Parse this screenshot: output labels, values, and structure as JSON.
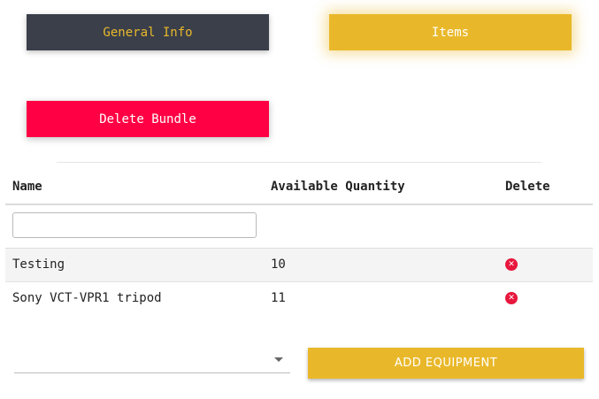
{
  "tabs": {
    "general_info": "General Info",
    "items": "Items"
  },
  "actions": {
    "delete_bundle": "Delete Bundle",
    "add_equipment": "ADD EQUIPMENT"
  },
  "table": {
    "headers": {
      "name": "Name",
      "available_quantity": "Available Quantity",
      "delete": "Delete"
    },
    "filter": {
      "value": "",
      "placeholder": ""
    },
    "rows": [
      {
        "name": "Testing",
        "quantity": "10",
        "delete_icon": "remove-circle-icon"
      },
      {
        "name": "Sony VCT-VPR1 tripod",
        "quantity": "11",
        "delete_icon": "remove-circle-icon"
      }
    ]
  },
  "equipment_select": {
    "selected": ""
  },
  "colors": {
    "accent": "#e9b82a",
    "dark": "#3a3f4a",
    "danger": "#ff0044",
    "delete_icon": "#e8173d"
  }
}
